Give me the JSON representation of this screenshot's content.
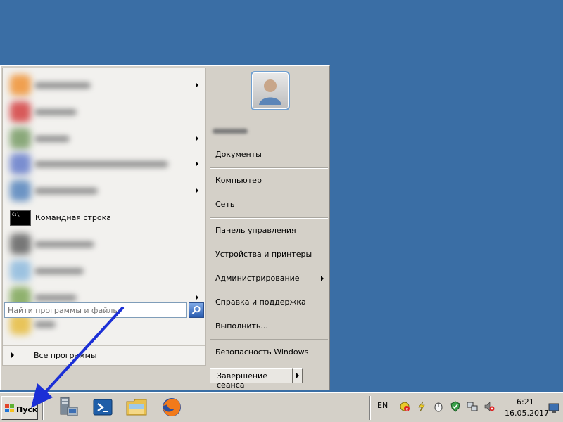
{
  "start_menu": {
    "pinned_programs": [
      {
        "label": "Командная строка"
      }
    ],
    "all_programs_label": "Все программы",
    "search": {
      "placeholder": "Найти программы и файлы"
    },
    "right_items": {
      "documents": "Документы",
      "computer": "Компьютер",
      "network": "Сеть",
      "control_panel": "Панель управления",
      "devices_printers": "Устройства и принтеры",
      "administration": "Администрирование",
      "help_support": "Справка и поддержка",
      "run": "Выполнить...",
      "windows_security": "Безопасность Windows"
    },
    "shutdown_label": "Завершение сеанса"
  },
  "taskbar": {
    "start_label": "Пуск",
    "quick_launch": [
      "server-manager-icon",
      "powershell-icon",
      "explorer-folder-icon",
      "firefox-icon"
    ],
    "language": "EN",
    "clock": {
      "time": "6:21",
      "date": "16.05.2017"
    }
  },
  "colors": {
    "desktop": "#3a6ea5",
    "menu": "#d4d0c8",
    "arrow_annotation": "#1b2fd6"
  }
}
